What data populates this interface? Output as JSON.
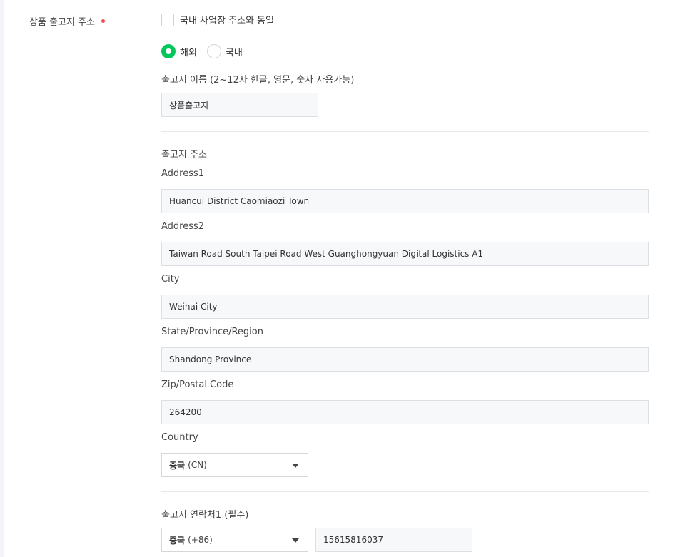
{
  "section": {
    "label": "상품 출고지 주소",
    "required_color": "#f2444b"
  },
  "same_as_domestic": {
    "label": "국내 사업장 주소와 동일",
    "checked": false
  },
  "location_type": {
    "options": [
      {
        "label": "해외",
        "selected": true
      },
      {
        "label": "국내",
        "selected": false
      }
    ],
    "accent": "#03c75a"
  },
  "origin_name": {
    "label": "출고지 이름 (2~12자 한글, 영문, 숫자 사용가능)",
    "value": "상품출고지"
  },
  "address": {
    "heading": "출고지 주소",
    "address1": {
      "label": "Address1",
      "value": "Huancui District Caomiaozi Town"
    },
    "address2": {
      "label": "Address2",
      "value": "Taiwan Road South Taipei Road West Guanghongyuan Digital Logistics A1"
    },
    "city": {
      "label": "City",
      "value": "Weihai City"
    },
    "state": {
      "label": "State/Province/Region",
      "value": "Shandong Province"
    },
    "zip": {
      "label": "Zip/Postal Code",
      "value": "264200"
    },
    "country": {
      "label": "Country",
      "selected_name": "중국",
      "selected_code": "(CN)"
    }
  },
  "contact1": {
    "label": "출고지 연락처1 (필수)",
    "country_name": "중국",
    "country_code": "(+86)",
    "phone": "15615816037"
  }
}
